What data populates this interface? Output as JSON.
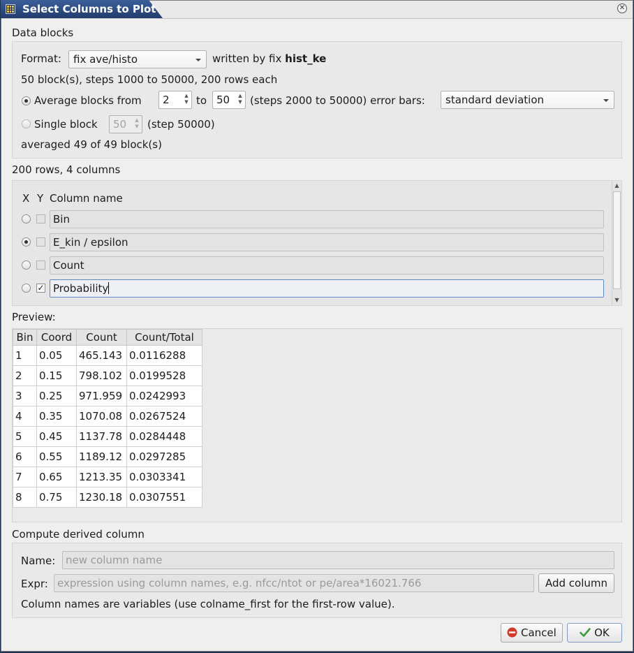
{
  "window": {
    "title": "Select Columns to Plot"
  },
  "data_blocks": {
    "heading": "Data blocks",
    "format_label": "Format:",
    "format_value": "fix ave/histo",
    "written_by": "written by fix",
    "fix_name": "hist_ke",
    "summary": "50 block(s), steps 1000 to 50000, 200 rows each",
    "average_label": "Average blocks  from",
    "avg_from": "2",
    "to_label": "to",
    "avg_to": "50",
    "avg_steps": "(steps 2000 to 50000) error bars:",
    "error_bars": "standard deviation",
    "single_label": "Single block",
    "single_value": "50",
    "single_step": "(step 50000)",
    "averaged": "averaged 49 of 49 block(s)"
  },
  "columns": {
    "heading": "200 rows, 4 columns",
    "header_x": "X",
    "header_y": "Y",
    "header_name": "Column name",
    "items": [
      {
        "name": "Bin",
        "x_selected": false,
        "y_checked": false
      },
      {
        "name": "E_kin / epsilon",
        "x_selected": true,
        "y_checked": false
      },
      {
        "name": "Count",
        "x_selected": false,
        "y_checked": false
      },
      {
        "name": "Probability",
        "x_selected": false,
        "y_checked": true
      }
    ]
  },
  "preview": {
    "heading": "Preview:",
    "headers": [
      "Bin",
      "Coord",
      "Count",
      "Count/Total"
    ],
    "rows": [
      [
        "1",
        "0.05",
        "465.143",
        "0.0116288"
      ],
      [
        "2",
        "0.15",
        "798.102",
        "0.0199528"
      ],
      [
        "3",
        "0.25",
        "971.959",
        "0.0242993"
      ],
      [
        "4",
        "0.35",
        "1070.08",
        "0.0267524"
      ],
      [
        "5",
        "0.45",
        "1137.78",
        "0.0284448"
      ],
      [
        "6",
        "0.55",
        "1189.12",
        "0.0297285"
      ],
      [
        "7",
        "0.65",
        "1213.35",
        "0.0303341"
      ],
      [
        "8",
        "0.75",
        "1230.18",
        "0.0307551"
      ]
    ]
  },
  "derived": {
    "heading": "Compute derived column",
    "name_label": "Name:",
    "name_placeholder": "new column name",
    "expr_label": "Expr:",
    "expr_placeholder": "expression using column names, e.g.  nfcc/ntot  or  pe/area*16021.766",
    "add_button": "Add column",
    "hint": "Column names are variables (use colname_first for the first-row value)."
  },
  "buttons": {
    "cancel": "Cancel",
    "ok": "OK"
  },
  "colors": {
    "titlebar": "#2f4f86",
    "focus": "#5b88c9",
    "cancel_icon": "#d23a2a",
    "ok_icon": "#3c9a3c"
  }
}
